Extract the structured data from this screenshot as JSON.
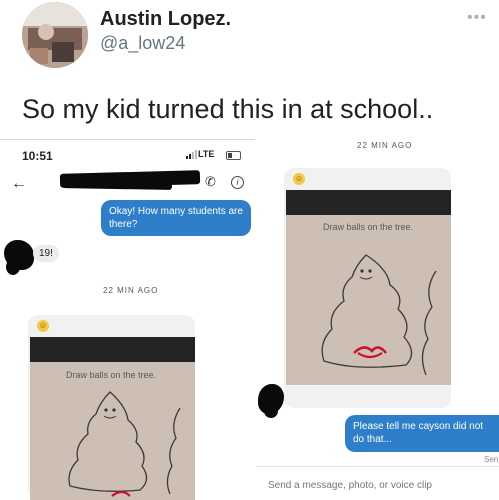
{
  "tweet": {
    "author_name": "Austin Lopez.",
    "author_handle": "@a_low24",
    "menu_glyph": "•••",
    "text": "So my kid turned this in at school.."
  },
  "left_screenshot": {
    "status_time": "10:51",
    "network": "LTE",
    "messages": {
      "outgoing": "Okay! How many students are there?",
      "incoming": "19!"
    },
    "timestamp": "22 MIN AGO",
    "worksheet_instruction": "Draw balls on the tree."
  },
  "right_screenshot": {
    "timestamp": "22 MIN AGO",
    "worksheet_instruction": "Draw balls on the tree.",
    "outgoing_message": "Please tell me cayson did not do that...",
    "send_status": "Sen",
    "composer_placeholder": "Send a message, photo, or voice clip"
  },
  "icons": {
    "back": "←",
    "phone": "✆",
    "info": "i",
    "emoji": "☺"
  },
  "colors": {
    "bubble_blue": "#2f7ec9",
    "bubble_gray": "#ececec",
    "paper": "#cdbfb3",
    "marker_red": "#c8102e"
  }
}
